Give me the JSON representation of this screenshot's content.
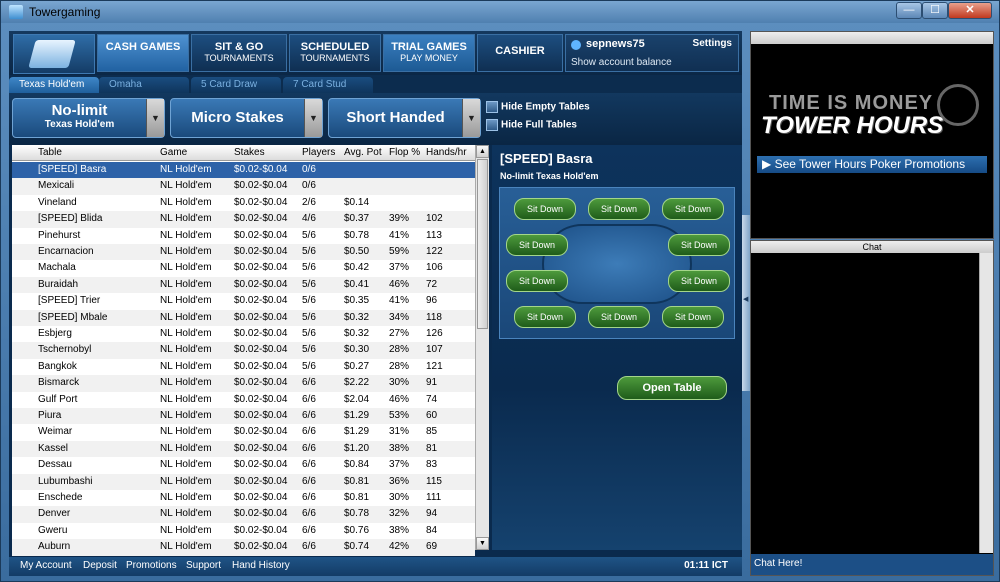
{
  "window": {
    "title": "Towergaming",
    "min": "—",
    "max": "☐",
    "close": "✕"
  },
  "nav": {
    "cash": {
      "l1": "CASH GAMES"
    },
    "sng": {
      "l1": "SIT & GO",
      "l2": "TOURNAMENTS"
    },
    "sched": {
      "l1": "SCHEDULED",
      "l2": "TOURNAMENTS"
    },
    "trial": {
      "l1": "TRIAL GAMES",
      "l2": "PLAY MONEY"
    },
    "cashier": {
      "l1": "CASHIER"
    }
  },
  "user": {
    "name": "sepnews75",
    "settings": "Settings",
    "balance": "Show account balance"
  },
  "subtabs": [
    "Texas Hold'em",
    "Omaha",
    "5 Card Draw",
    "7 Card Stud"
  ],
  "filters": {
    "limit": {
      "t1": "No-limit",
      "t2": "Texas Hold'em"
    },
    "stakes": "Micro Stakes",
    "seats": "Short Handed",
    "arrow": "▼",
    "hide_empty": "Hide Empty Tables",
    "hide_full": "Hide Full Tables"
  },
  "table": {
    "headers": [
      "Table",
      "Game",
      "Stakes",
      "Players",
      "Avg. Pot",
      "Flop %",
      "Hands/hr"
    ],
    "rows": [
      [
        "[SPEED] Basra",
        "NL Hold'em",
        "$0.02-$0.04",
        "0/6",
        "",
        "",
        ""
      ],
      [
        "Mexicali",
        "NL Hold'em",
        "$0.02-$0.04",
        "0/6",
        "",
        "",
        ""
      ],
      [
        "Vineland",
        "NL Hold'em",
        "$0.02-$0.04",
        "2/6",
        "$0.14",
        "",
        ""
      ],
      [
        "[SPEED] Blida",
        "NL Hold'em",
        "$0.02-$0.04",
        "4/6",
        "$0.37",
        "39%",
        "102"
      ],
      [
        "Pinehurst",
        "NL Hold'em",
        "$0.02-$0.04",
        "5/6",
        "$0.78",
        "41%",
        "113"
      ],
      [
        "Encarnacion",
        "NL Hold'em",
        "$0.02-$0.04",
        "5/6",
        "$0.50",
        "59%",
        "122"
      ],
      [
        "Machala",
        "NL Hold'em",
        "$0.02-$0.04",
        "5/6",
        "$0.42",
        "37%",
        "106"
      ],
      [
        "Buraidah",
        "NL Hold'em",
        "$0.02-$0.04",
        "5/6",
        "$0.41",
        "46%",
        "72"
      ],
      [
        "[SPEED] Trier",
        "NL Hold'em",
        "$0.02-$0.04",
        "5/6",
        "$0.35",
        "41%",
        "96"
      ],
      [
        "[SPEED] Mbale",
        "NL Hold'em",
        "$0.02-$0.04",
        "5/6",
        "$0.32",
        "34%",
        "118"
      ],
      [
        "Esbjerg",
        "NL Hold'em",
        "$0.02-$0.04",
        "5/6",
        "$0.32",
        "27%",
        "126"
      ],
      [
        "Tschernobyl",
        "NL Hold'em",
        "$0.02-$0.04",
        "5/6",
        "$0.30",
        "28%",
        "107"
      ],
      [
        "Bangkok",
        "NL Hold'em",
        "$0.02-$0.04",
        "5/6",
        "$0.27",
        "28%",
        "121"
      ],
      [
        "Bismarck",
        "NL Hold'em",
        "$0.02-$0.04",
        "6/6",
        "$2.22",
        "30%",
        "91"
      ],
      [
        "Gulf Port",
        "NL Hold'em",
        "$0.02-$0.04",
        "6/6",
        "$2.04",
        "46%",
        "74"
      ],
      [
        "Piura",
        "NL Hold'em",
        "$0.02-$0.04",
        "6/6",
        "$1.29",
        "53%",
        "60"
      ],
      [
        "Weimar",
        "NL Hold'em",
        "$0.02-$0.04",
        "6/6",
        "$1.29",
        "31%",
        "85"
      ],
      [
        "Kassel",
        "NL Hold'em",
        "$0.02-$0.04",
        "6/6",
        "$1.20",
        "38%",
        "81"
      ],
      [
        "Dessau",
        "NL Hold'em",
        "$0.02-$0.04",
        "6/6",
        "$0.84",
        "37%",
        "83"
      ],
      [
        "Lubumbashi",
        "NL Hold'em",
        "$0.02-$0.04",
        "6/6",
        "$0.81",
        "36%",
        "115"
      ],
      [
        "Enschede",
        "NL Hold'em",
        "$0.02-$0.04",
        "6/6",
        "$0.81",
        "30%",
        "111"
      ],
      [
        "Denver",
        "NL Hold'em",
        "$0.02-$0.04",
        "6/6",
        "$0.78",
        "32%",
        "94"
      ],
      [
        "Gweru",
        "NL Hold'em",
        "$0.02-$0.04",
        "6/6",
        "$0.76",
        "38%",
        "84"
      ],
      [
        "Auburn",
        "NL Hold'em",
        "$0.02-$0.04",
        "6/6",
        "$0.74",
        "42%",
        "69"
      ]
    ],
    "scroll_up": "▲",
    "scroll_down": "▼"
  },
  "preview": {
    "title": "[SPEED] Basra",
    "subtitle": "No-limit Texas Hold'em",
    "seat_label": "Sit Down",
    "open": "Open Table"
  },
  "footer": {
    "links": [
      "My Account",
      "Deposit",
      "Promotions",
      "Support",
      "Hand History"
    ],
    "clock": "01:11 ICT"
  },
  "collapse_arrow": "◀",
  "ad": {
    "line1": "TIME IS MONEY",
    "line2": "TOWER HOURS",
    "link": "▶ See Tower Hours Poker Promotions"
  },
  "chat": {
    "header": "Chat",
    "input": "Chat Here!"
  }
}
